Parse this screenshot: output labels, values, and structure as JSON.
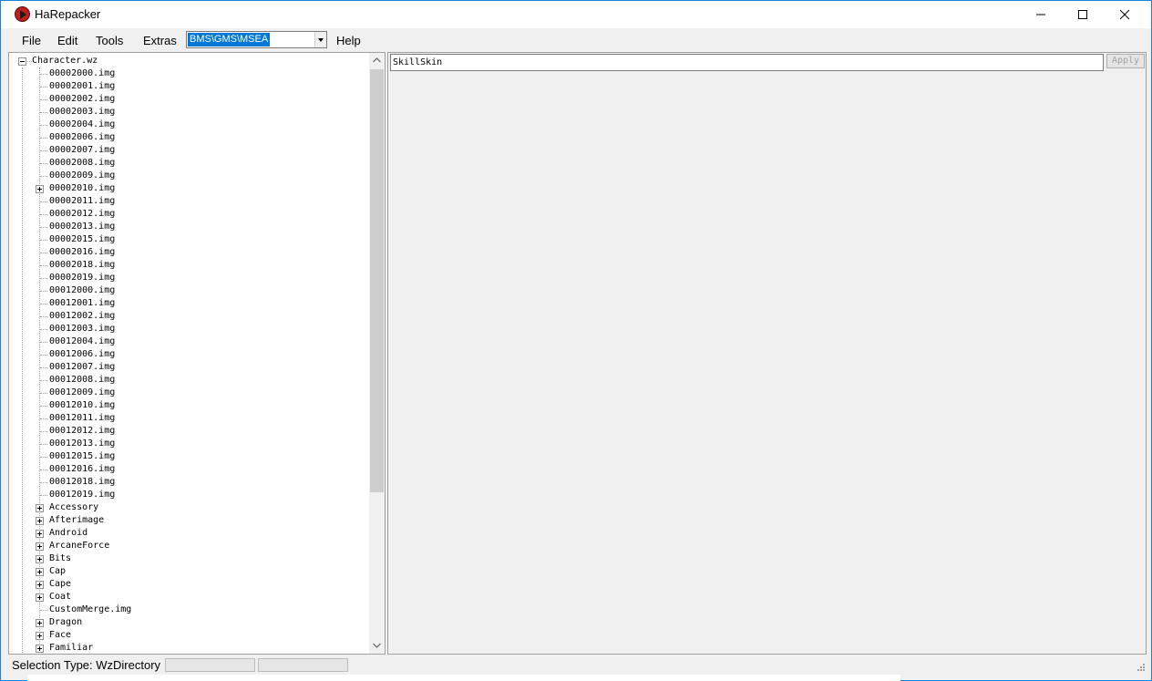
{
  "window": {
    "title": "HaRepacker"
  },
  "menu": {
    "items": [
      "File",
      "Edit",
      "Tools",
      "Extras",
      "Help"
    ],
    "region_select": {
      "value": "BMS\\GMS\\MSEA"
    }
  },
  "tree": {
    "root": "Character.wz",
    "children": [
      {
        "label": "00002000.img",
        "expandable": false
      },
      {
        "label": "00002001.img",
        "expandable": false
      },
      {
        "label": "00002002.img",
        "expandable": false
      },
      {
        "label": "00002003.img",
        "expandable": false
      },
      {
        "label": "00002004.img",
        "expandable": false
      },
      {
        "label": "00002006.img",
        "expandable": false
      },
      {
        "label": "00002007.img",
        "expandable": false
      },
      {
        "label": "00002008.img",
        "expandable": false
      },
      {
        "label": "00002009.img",
        "expandable": false
      },
      {
        "label": "00002010.img",
        "expandable": true
      },
      {
        "label": "00002011.img",
        "expandable": false
      },
      {
        "label": "00002012.img",
        "expandable": false
      },
      {
        "label": "00002013.img",
        "expandable": false
      },
      {
        "label": "00002015.img",
        "expandable": false
      },
      {
        "label": "00002016.img",
        "expandable": false
      },
      {
        "label": "00002018.img",
        "expandable": false
      },
      {
        "label": "00002019.img",
        "expandable": false
      },
      {
        "label": "00012000.img",
        "expandable": false
      },
      {
        "label": "00012001.img",
        "expandable": false
      },
      {
        "label": "00012002.img",
        "expandable": false
      },
      {
        "label": "00012003.img",
        "expandable": false
      },
      {
        "label": "00012004.img",
        "expandable": false
      },
      {
        "label": "00012006.img",
        "expandable": false
      },
      {
        "label": "00012007.img",
        "expandable": false
      },
      {
        "label": "00012008.img",
        "expandable": false
      },
      {
        "label": "00012009.img",
        "expandable": false
      },
      {
        "label": "00012010.img",
        "expandable": false
      },
      {
        "label": "00012011.img",
        "expandable": false
      },
      {
        "label": "00012012.img",
        "expandable": false
      },
      {
        "label": "00012013.img",
        "expandable": false
      },
      {
        "label": "00012015.img",
        "expandable": false
      },
      {
        "label": "00012016.img",
        "expandable": false
      },
      {
        "label": "00012018.img",
        "expandable": false
      },
      {
        "label": "00012019.img",
        "expandable": false
      },
      {
        "label": "Accessory",
        "expandable": true
      },
      {
        "label": "Afterimage",
        "expandable": true
      },
      {
        "label": "Android",
        "expandable": true
      },
      {
        "label": "ArcaneForce",
        "expandable": true
      },
      {
        "label": "Bits",
        "expandable": true
      },
      {
        "label": "Cap",
        "expandable": true
      },
      {
        "label": "Cape",
        "expandable": true
      },
      {
        "label": "Coat",
        "expandable": true
      },
      {
        "label": "CustomMerge.img",
        "expandable": false
      },
      {
        "label": "Dragon",
        "expandable": true
      },
      {
        "label": "Face",
        "expandable": true
      },
      {
        "label": "Familiar",
        "expandable": true
      }
    ]
  },
  "editor": {
    "name_value": "SkillSkin",
    "apply_label": "Apply"
  },
  "status": {
    "selection_type": "Selection Type: WzDirectory"
  }
}
